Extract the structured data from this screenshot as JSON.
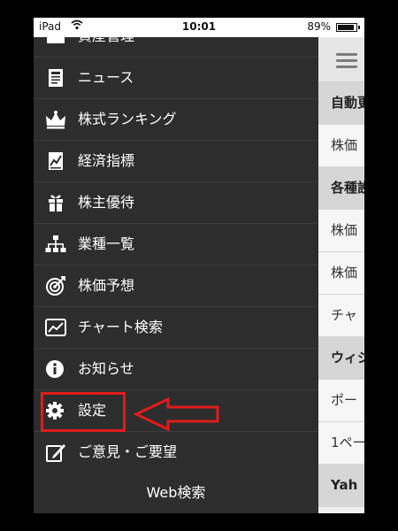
{
  "status_bar": {
    "carrier": "iPad",
    "time": "10:01",
    "battery_percent": "89%",
    "battery_level": 0.89
  },
  "menu": {
    "items": [
      {
        "label": "資産管理",
        "icon": "portfolio-icon"
      },
      {
        "label": "ニュース",
        "icon": "news-icon"
      },
      {
        "label": "株式ランキング",
        "icon": "crown-icon"
      },
      {
        "label": "経済指標",
        "icon": "indicator-icon"
      },
      {
        "label": "株主優待",
        "icon": "gift-icon"
      },
      {
        "label": "業種一覧",
        "icon": "sitemap-icon"
      },
      {
        "label": "株価予想",
        "icon": "target-icon"
      },
      {
        "label": "チャート検索",
        "icon": "chart-icon"
      },
      {
        "label": "お知らせ",
        "icon": "info-icon"
      },
      {
        "label": "設定",
        "icon": "gear-icon"
      },
      {
        "label": "ご意見・ご要望",
        "icon": "feedback-icon"
      }
    ],
    "web_search": "Web検索"
  },
  "content": {
    "rows": [
      {
        "text": "自動更",
        "section": true
      },
      {
        "text": "株価",
        "section": false
      },
      {
        "text": "各種設",
        "section": true
      },
      {
        "text": "株価",
        "section": false
      },
      {
        "text": "株価",
        "section": false
      },
      {
        "text": "チャ",
        "section": false
      },
      {
        "text": "ウィジ",
        "section": true
      },
      {
        "text": "ポー",
        "section": false
      },
      {
        "text": "1ペー",
        "section": false
      },
      {
        "text": "Yah",
        "section": true
      }
    ]
  },
  "colors": {
    "menu_bg": "#2d2d2d",
    "annotation_red": "#e01b1b"
  }
}
